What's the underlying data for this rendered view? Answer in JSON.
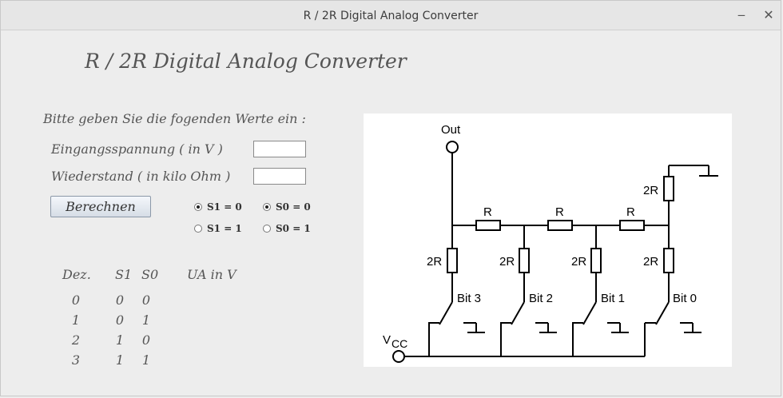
{
  "window": {
    "title": "R / 2R Digital Analog Converter",
    "minimize_glyph": "‒",
    "close_glyph": "✕"
  },
  "heading": "R / 2R Digital Analog Converter",
  "form": {
    "instruction": "Bitte geben Sie die fogenden Werte ein :",
    "voltage_label": "Eingangsspannung ( in V )",
    "voltage_value": "",
    "resistance_label": "Wiederstand ( in kilo Ohm )",
    "resistance_value": "",
    "calculate_label": "Berechnen"
  },
  "radios": {
    "s1_0": {
      "label": "S1 = 0",
      "checked": true
    },
    "s0_0": {
      "label": "S0 = 0",
      "checked": true
    },
    "s1_1": {
      "label": "S1 = 1",
      "checked": false
    },
    "s0_1": {
      "label": "S0 = 1",
      "checked": false
    }
  },
  "table": {
    "headers": [
      "Dez.",
      "S1",
      "S0",
      "UA in V"
    ],
    "rows": [
      [
        "0",
        "0",
        "0"
      ],
      [
        "1",
        "0",
        "1"
      ],
      [
        "2",
        "1",
        "0"
      ],
      [
        "3",
        "1",
        "1"
      ]
    ]
  },
  "circuit": {
    "out_label": "Out",
    "vcc_label": "V",
    "vcc_sub": "CC",
    "r_label": "R",
    "r2_label": "2R",
    "bits": [
      "Bit 3",
      "Bit 2",
      "Bit 1",
      "Bit 0"
    ]
  }
}
